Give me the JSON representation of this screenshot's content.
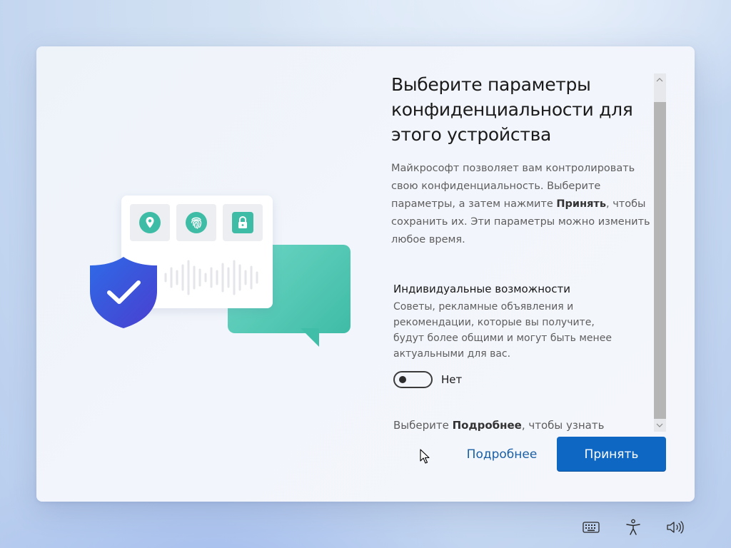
{
  "dialog": {
    "title": "Выберите параметры конфиденциальности для этого устройства",
    "intro_before": "Майкрософт позволяет вам контролировать свою конфиденциальность. Выберите параметры, а затем нажмите ",
    "intro_bold": "Принять",
    "intro_after": ", чтобы сохранить их. Эти параметры можно изменить в любое время."
  },
  "illustration": {
    "icons": [
      "location-pin-icon",
      "fingerprint-icon",
      "lock-icon",
      "shield-check-icon"
    ]
  },
  "settings": [
    {
      "title": "Индивидуальные возможности",
      "description": "Советы, рекламные объявления и рекомендации, которые вы получите, будут более общими и могут быть менее актуальными для вас.",
      "toggle_state": "Нет",
      "toggle_on": false
    }
  ],
  "more_hint": {
    "before": "Выберите ",
    "bold": "Подробнее",
    "after": ", чтобы узнать"
  },
  "buttons": {
    "more": "Подробнее",
    "accept": "Принять"
  },
  "tray": {
    "icons": [
      "keyboard-icon",
      "accessibility-icon",
      "volume-icon"
    ]
  },
  "colors": {
    "accent": "#0f67c4",
    "link": "#1a5fa6",
    "teal": "#3fbca6",
    "shield": "#3b5bdb"
  }
}
